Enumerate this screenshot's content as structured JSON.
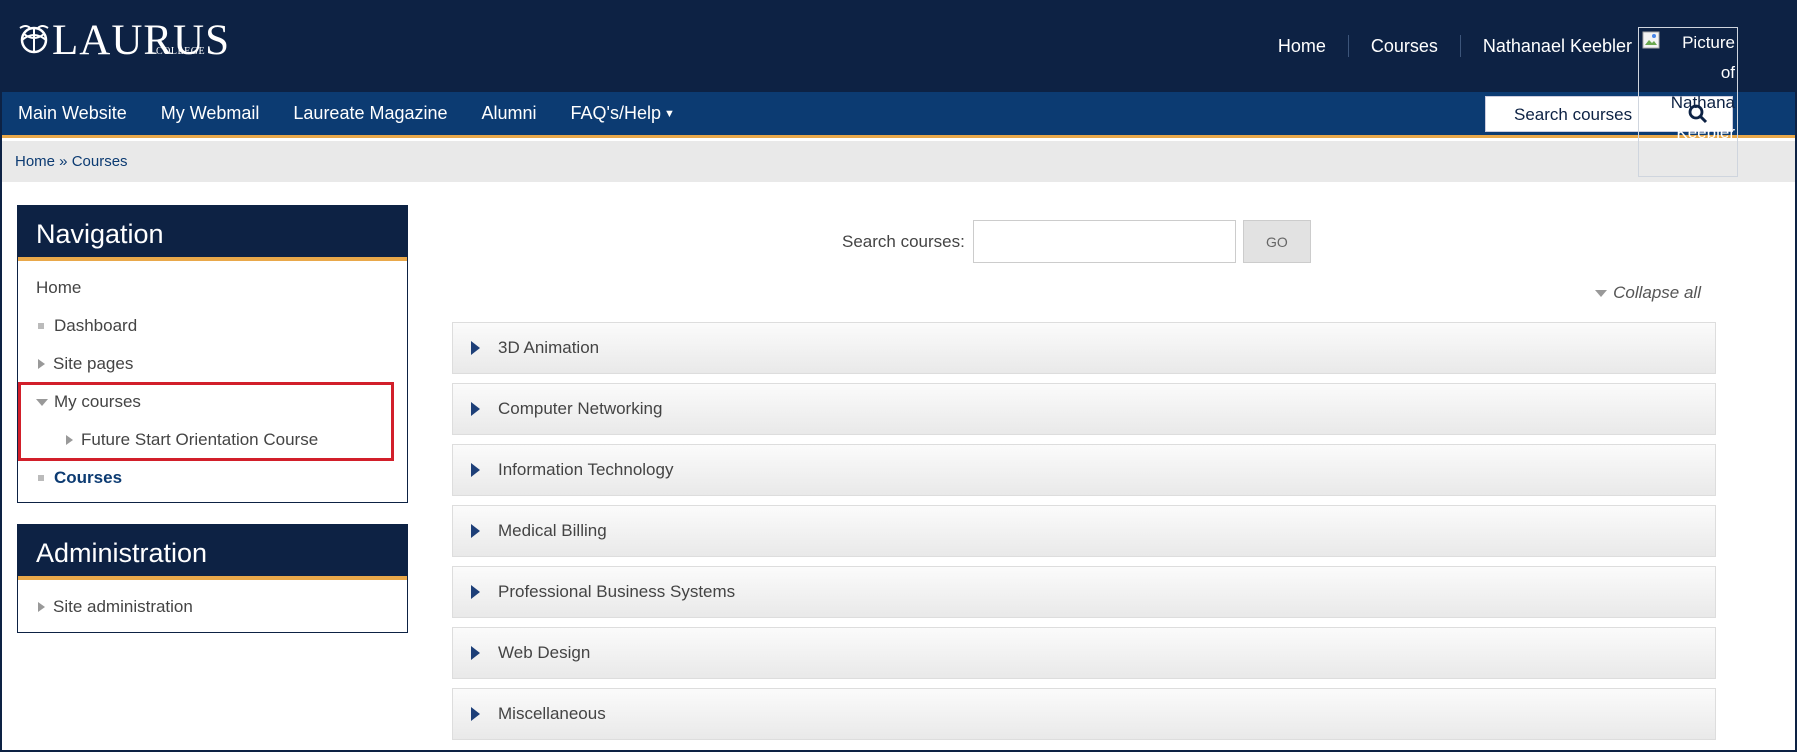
{
  "brand": {
    "name": "LAURUS",
    "sub": "COLLEGE"
  },
  "topnav": {
    "home": "Home",
    "courses": "Courses",
    "user": "Nathanael Keebler"
  },
  "avatar_alt": {
    "l1": "Picture",
    "l2": "of",
    "l3": "Nathana",
    "l4": "Keebler"
  },
  "menu": {
    "items": [
      "Main Website",
      "My Webmail",
      "Laureate Magazine",
      "Alumni",
      "FAQ's/Help"
    ]
  },
  "top_search": {
    "placeholder": "Search courses"
  },
  "breadcrumb": {
    "text": "Home » Courses"
  },
  "navigation": {
    "title": "Navigation",
    "home": "Home",
    "dashboard": "Dashboard",
    "site_pages": "Site pages",
    "my_courses": "My courses",
    "future_course": "Future Start Orientation Course",
    "courses": "Courses"
  },
  "administration": {
    "title": "Administration",
    "site_admin": "Site administration"
  },
  "main": {
    "search_label": "Search courses:",
    "go_label": "GO",
    "collapse_all": "Collapse all",
    "categories": [
      "3D Animation",
      "Computer Networking",
      "Information Technology",
      "Medical Billing",
      "Professional Business Systems",
      "Web Design",
      "Miscellaneous"
    ]
  },
  "colors": {
    "navy": "#0d2244",
    "menu_blue": "#0c3b72",
    "accent_orange": "#e9a84a",
    "highlight_red": "#d21f2a"
  }
}
